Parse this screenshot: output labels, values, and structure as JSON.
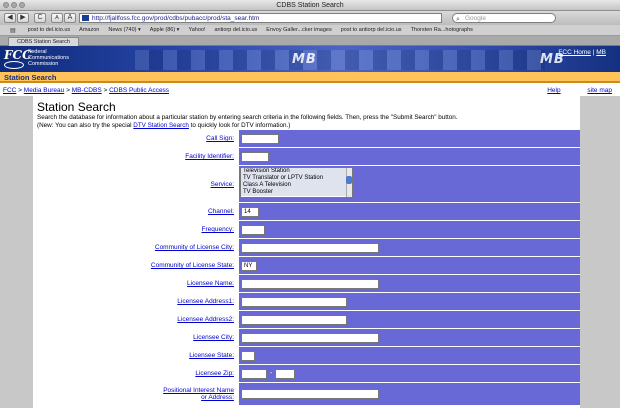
{
  "window": {
    "title": "CDBS Station Search"
  },
  "toolbar": {
    "back_label": "◀",
    "forward_label": "▶",
    "reload_label": "C",
    "text_small_label": "A",
    "text_large_label": "A",
    "address_url": "http://fjallfoss.fcc.gov/prod/cdbs/pubacc/prod/sta_sear.htm",
    "search_placeholder": "Google"
  },
  "bookmarks": [
    "post to del.icio.us",
    "Amazon",
    "News (740) ▾",
    "Apple (86) ▾",
    "Yahoo!",
    "antiorp del.icio.us",
    "Envoy Galler...cker images",
    "post to antiorp del.icio.us",
    "Thorsten Ra...hotographs"
  ],
  "tab": {
    "label": "CDBS Station Search"
  },
  "banner": {
    "logo_text": "FCC",
    "org_name": "Federal Communications Commission",
    "mb_mark": "MB",
    "home_link": "FCC Home",
    "separator": "|",
    "mb_link": "MB"
  },
  "section": {
    "title": "Station Search"
  },
  "breadcrumb": {
    "items": [
      "FCC",
      "Media Bureau",
      "MB-CDBS",
      "CDBS Public Access"
    ],
    "separator": " > "
  },
  "help": {
    "help_label": "Help",
    "sitemap_label": "site map"
  },
  "content": {
    "heading": "Station Search",
    "intro_line1": "Search the database for information about a particular station by entering search criteria in the following fields. Then, press the \"Submit Search\" button.",
    "intro_line2_pre": "(New: You can also try the special ",
    "intro_link": "DTV Station Search",
    "intro_line2_post": " to quickly look for DTV information.)"
  },
  "form": {
    "call_sign": {
      "label": "Call Sign:",
      "value": ""
    },
    "facility_id": {
      "label": "Facility Identifier:",
      "value": ""
    },
    "service": {
      "label": "Service:",
      "options": [
        "Television Station",
        "TV Translator or LPTV Station",
        "Class A Television",
        "TV Booster"
      ]
    },
    "channel": {
      "label": "Channel:",
      "value": "14"
    },
    "frequency": {
      "label": "Frequency:",
      "value": ""
    },
    "community_city": {
      "label": "Community of License City:",
      "value": ""
    },
    "community_state": {
      "label": "Community of License State:",
      "value": "NY"
    },
    "licensee_name": {
      "label": "Licensee Name:",
      "value": ""
    },
    "licensee_address1": {
      "label": "Licensee Address1:",
      "value": ""
    },
    "licensee_address2": {
      "label": "Licensee Address2:",
      "value": ""
    },
    "licensee_city": {
      "label": "Licensee City:",
      "value": ""
    },
    "licensee_state": {
      "label": "Licensee State:",
      "value": ""
    },
    "licensee_zip": {
      "label": "Licensee Zip:",
      "value": "",
      "value_ext": "",
      "separator": "-"
    },
    "positional": {
      "label_line1": "Positional Interest Name",
      "label_line2": "or Address:",
      "value": ""
    }
  }
}
